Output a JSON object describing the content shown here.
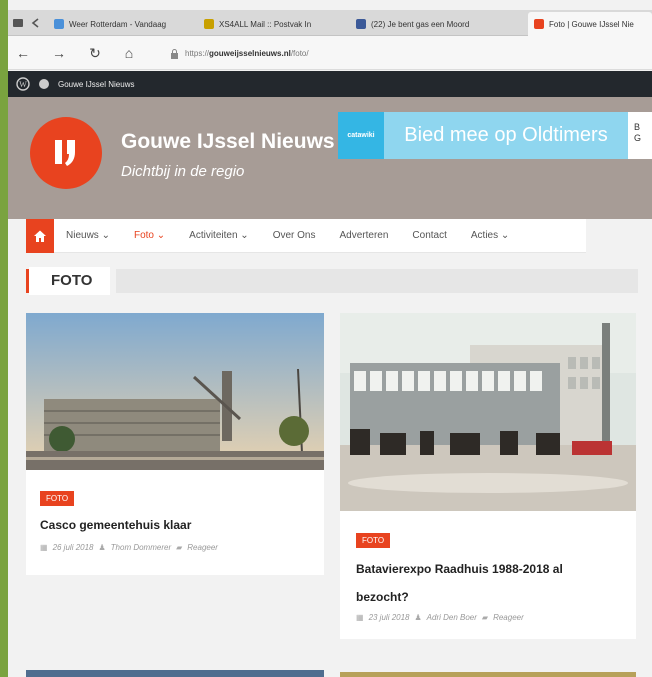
{
  "browser": {
    "tabs": [
      {
        "title": "Weer Rotterdam - Vandaag",
        "color": "#4a90d9"
      },
      {
        "title": "XS4ALL Mail :: Postvak In",
        "color": "#c8a000"
      },
      {
        "title": "(22) Je bent gas een Moord",
        "color": "#3b5998"
      },
      {
        "title": "Foto | Gouwe IJssel Nie",
        "color": "#e8431f"
      }
    ],
    "url_scheme": "https://",
    "url_host": "gouweijsselnieuws.nl",
    "url_path": "/foto/"
  },
  "adminbar": {
    "site_label": "Gouwe IJssel Nieuws"
  },
  "site": {
    "title": "Gouwe IJssel Nieuws",
    "tagline": "Dichtbij in de regio",
    "brand_color": "#e8431f"
  },
  "ad": {
    "logo_text": "catawiki",
    "headline": "Bied mee op Oldtimers",
    "side_text_1": "B",
    "side_text_2": "G"
  },
  "menu": {
    "items": [
      {
        "label": "Nieuws",
        "dropdown": true
      },
      {
        "label": "Foto",
        "dropdown": true,
        "active": true
      },
      {
        "label": "Activiteiten",
        "dropdown": true
      },
      {
        "label": "Over Ons"
      },
      {
        "label": "Adverteren"
      },
      {
        "label": "Contact"
      },
      {
        "label": "Acties",
        "dropdown": true
      }
    ]
  },
  "section": {
    "title": "FOTO"
  },
  "posts": [
    {
      "category": "FOTO",
      "title": "Casco gemeentehuis klaar",
      "date": "26 juli 2018",
      "author": "Thom Dommerer",
      "comments": "Reageer"
    },
    {
      "category": "FOTO",
      "title_line1": "Batavierexpo Raadhuis 1988-2018 al",
      "title_line2": "bezocht?",
      "date": "23 juli 2018",
      "author": "Adri Den Boer",
      "comments": "Reageer"
    }
  ]
}
